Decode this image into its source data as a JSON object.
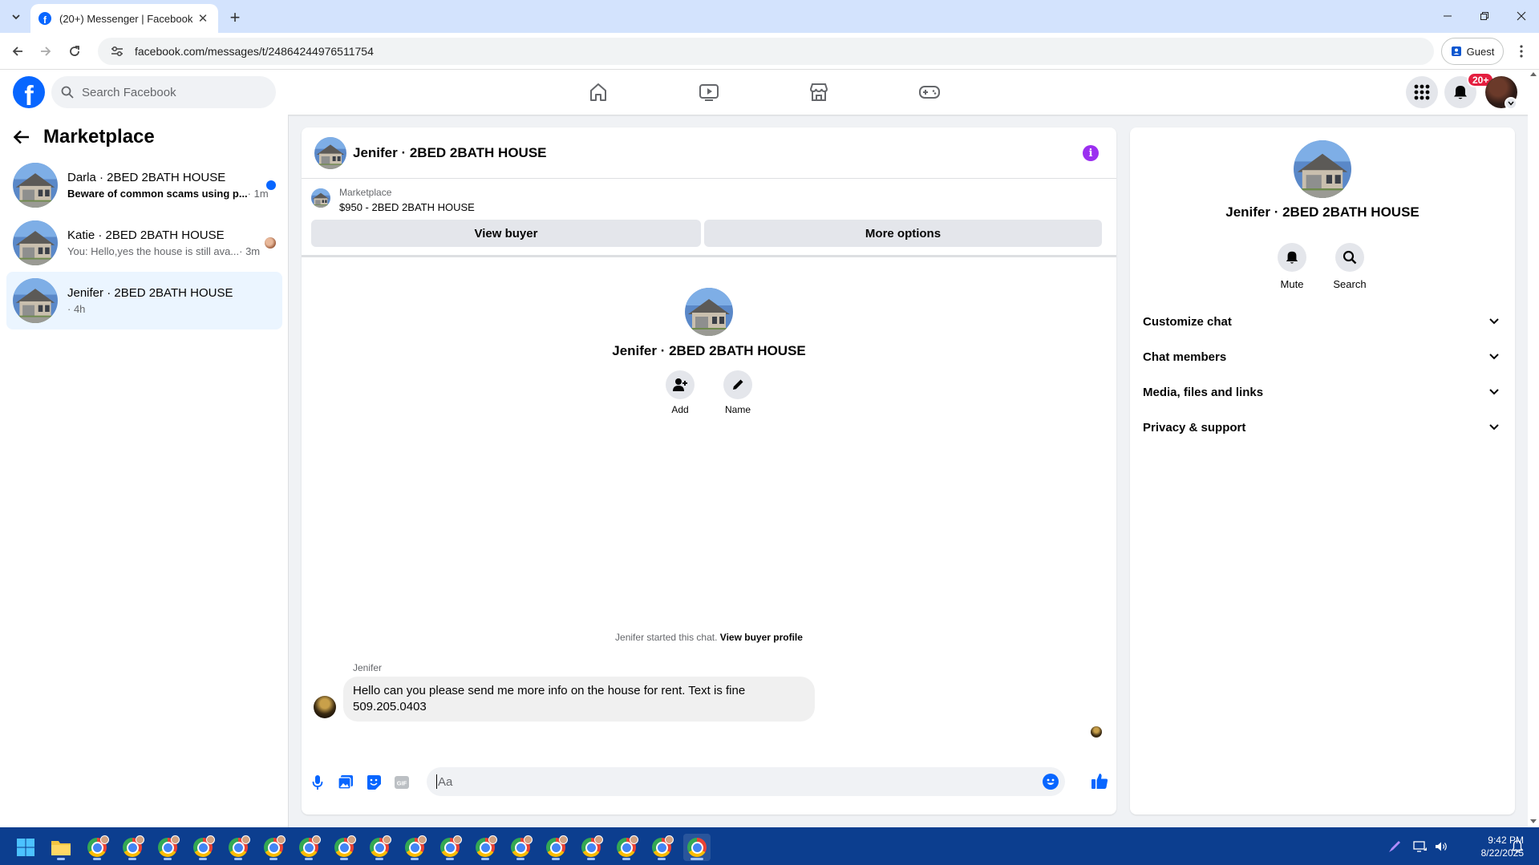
{
  "browser": {
    "tab_title": "(20+) Messenger | Facebook",
    "url": "facebook.com/messages/t/24864244976511754",
    "guest_label": "Guest"
  },
  "fb_header": {
    "search_placeholder": "Search Facebook",
    "notification_badge": "20+",
    "nav_icons": [
      "home-icon",
      "video-icon",
      "marketplace-icon",
      "gaming-icon"
    ]
  },
  "left_panel": {
    "title": "Marketplace",
    "conversations": [
      {
        "name": "Darla · 2BED 2BATH HOUSE",
        "preview": "Beware of common scams using p...",
        "time": "· 1m",
        "unread": true
      },
      {
        "name": "Katie · 2BED 2BATH HOUSE",
        "preview": "You: Hello,yes the house is still ava...",
        "time": "· 3m",
        "unread": false
      },
      {
        "name": "Jenifer · 2BED 2BATH HOUSE",
        "preview": "",
        "time": "· 4h",
        "unread": false
      }
    ]
  },
  "chat": {
    "title": "Jenifer · 2BED 2BATH HOUSE",
    "listing_category": "Marketplace",
    "listing_price": "$950 - 2BED 2BATH HOUSE",
    "view_buyer_label": "View buyer",
    "more_options_label": "More options",
    "intro_name": "Jenifer · 2BED 2BATH HOUSE",
    "add_label": "Add",
    "name_label": "Name",
    "started_text": "Jenifer started this chat.",
    "view_profile_label": "View buyer profile",
    "sender_name": "Jenifer",
    "message_line1": "Hello can you please send me more info on the house for rent. Text is fine",
    "message_line2": "509.205.0403",
    "composer_placeholder": "Aa"
  },
  "right_panel": {
    "name": "Jenifer · 2BED 2BATH HOUSE",
    "mute_label": "Mute",
    "search_label": "Search",
    "sections": [
      "Customize chat",
      "Chat members",
      "Media, files and links",
      "Privacy & support"
    ]
  },
  "taskbar": {
    "time": "9:42 PM",
    "date": "8/22/2025"
  },
  "colors": {
    "fb_blue": "#0866ff",
    "active_conversation": "#ebf5ff",
    "taskbar": "#0c3e8f",
    "badge_red": "#e41e3f"
  }
}
